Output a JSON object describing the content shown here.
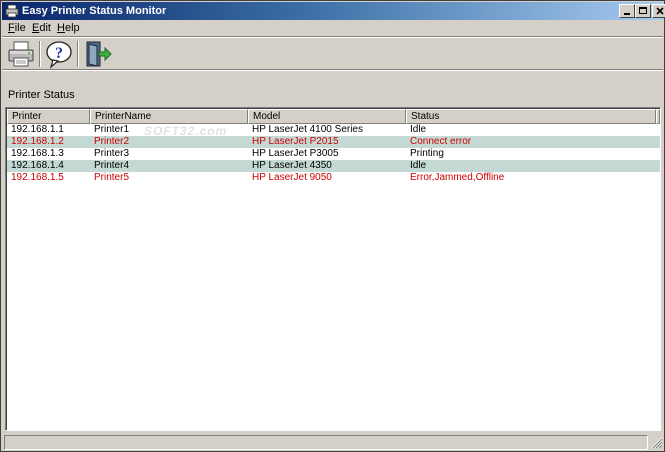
{
  "window": {
    "title": "Easy Printer Status Monitor"
  },
  "menu": [
    {
      "label": "File",
      "accel": "F",
      "rest": "ile"
    },
    {
      "label": "Edit",
      "accel": "E",
      "rest": "dit"
    },
    {
      "label": "Help",
      "accel": "H",
      "rest": "elp"
    }
  ],
  "toolbar": {
    "buttons": [
      {
        "icon": "printer-icon"
      },
      {
        "icon": "help-icon"
      },
      {
        "icon": "exit-icon"
      }
    ]
  },
  "section_label": "Printer Status",
  "table": {
    "columns": [
      "Printer",
      "PrinterName",
      "Model",
      "Status"
    ],
    "rows": [
      {
        "printer": "192.168.1.1",
        "name": "Printer1",
        "model": "HP LaserJet 4100 Series",
        "status": "Idle",
        "error": false
      },
      {
        "printer": "192.168.1.2",
        "name": "Printer2",
        "model": "HP LaserJet P2015",
        "status": "Connect error",
        "error": true
      },
      {
        "printer": "192.168.1.3",
        "name": "Printer3",
        "model": "HP LaserJet P3005",
        "status": "Printing",
        "error": false
      },
      {
        "printer": "192.168.1.4",
        "name": "Printer4",
        "model": "HP LaserJet 4350",
        "status": "Idle",
        "error": false
      },
      {
        "printer": "192.168.1.5",
        "name": "Printer5",
        "model": "HP LaserJet 9050",
        "status": "Error,Jammed,Offline",
        "error": true
      }
    ]
  },
  "watermark": "SOFT32.com",
  "colors": {
    "titlebar_start": "#0a246a",
    "titlebar_end": "#a6caf0",
    "row_alt": "#c4d9d4",
    "error_text": "#cc0000"
  }
}
